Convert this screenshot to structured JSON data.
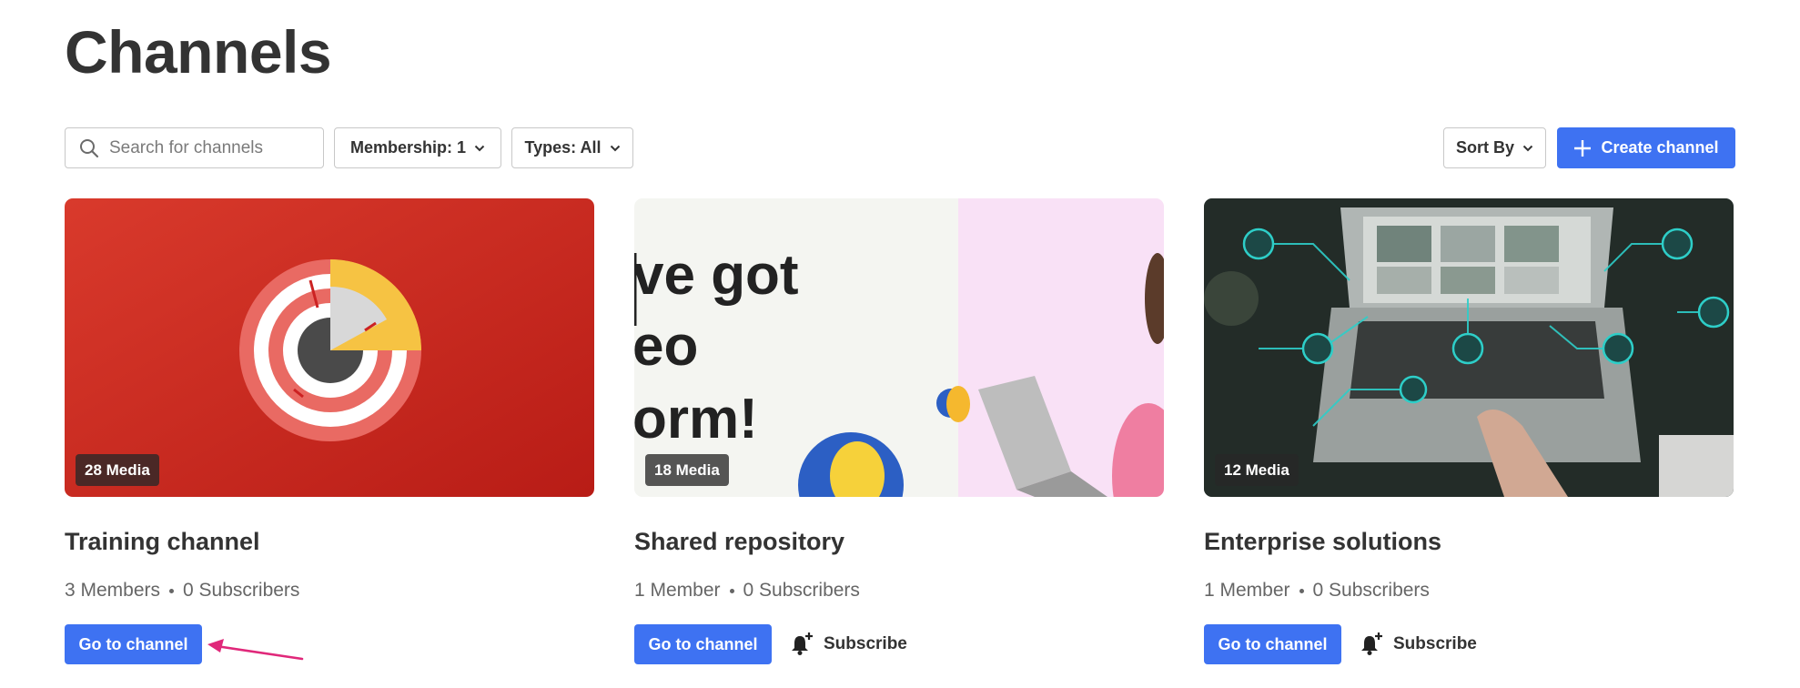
{
  "page": {
    "title": "Channels"
  },
  "toolbar": {
    "search": {
      "placeholder": "Search for channels",
      "value": ""
    },
    "membership_label": "Membership: 1",
    "types_label": "Types: All",
    "sort_label": "Sort By",
    "create_label": "Create channel"
  },
  "channels": [
    {
      "title": "Training channel",
      "media": "28 Media",
      "members": "3 Members",
      "subscribers": "0 Subscribers",
      "go_label": "Go to channel"
    },
    {
      "title": "Shared repository",
      "media": "18 Media",
      "members": "1 Member",
      "subscribers": "0 Subscribers",
      "go_label": "Go to channel",
      "subscribe_label": "Subscribe",
      "thumb_text": [
        "ve got",
        "eo",
        "orm!"
      ]
    },
    {
      "title": "Enterprise solutions",
      "media": "12 Media",
      "members": "1 Member",
      "subscribers": "0 Subscribers",
      "go_label": "Go to channel",
      "subscribe_label": "Subscribe"
    }
  ],
  "colors": {
    "accent": "#3e72f2",
    "annotation_arrow": "#e0287a"
  }
}
